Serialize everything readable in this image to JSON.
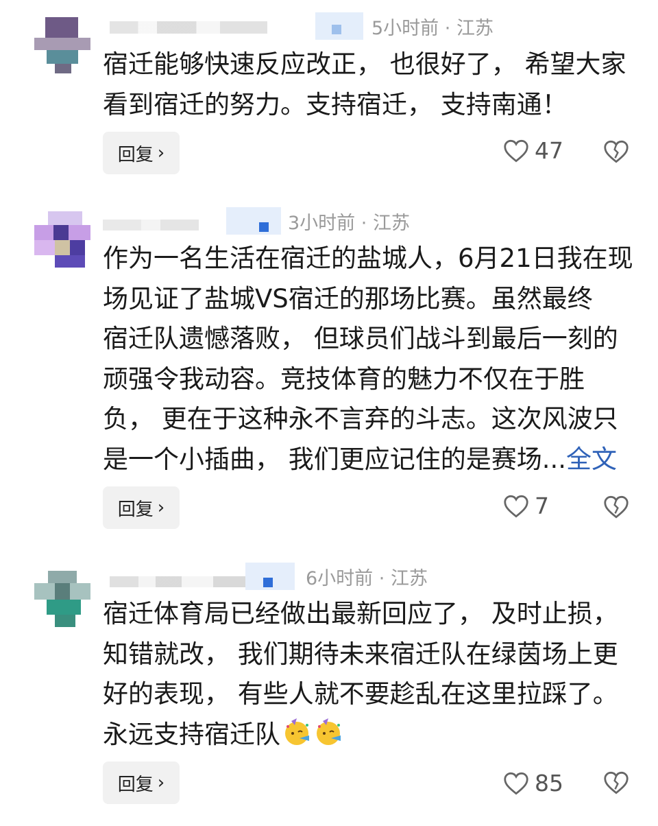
{
  "comments": [
    {
      "time": "5小时前",
      "sep": "·",
      "region": "江苏",
      "lines": [
        "宿迁能够快速反应改正， 也很好了， 希望大家",
        "看到宿迁的努力。支持宿迁， 支持南通！"
      ],
      "reply_label": "回复",
      "like_count": "47"
    },
    {
      "time": "3小时前",
      "sep": "·",
      "region": "江苏",
      "lines": [
        "作为一名生活在宿迁的盐城人，6月21日我在现",
        "场见证了盐城VS宿迁的那场比赛。虽然最终",
        "宿迁队遗憾落败， 但球员们战斗到最后一刻的",
        "顽强令我动容。竞技体育的魅力不仅在于胜",
        "负， 更在于这种永不言弃的斗志。这次风波只"
      ],
      "last_line": "是一个小插曲， 我们更应记住的是赛场...",
      "more_label": "全文",
      "reply_label": "回复",
      "like_count": "7"
    },
    {
      "time": "6小时前",
      "sep": "·",
      "region": "江苏",
      "lines": [
        "宿迁体育局已经做出最新回应了， 及时止损，",
        "知错就改， 我们期待未来宿迁队在绿茵场上更",
        "好的表现， 有些人就不要趁乱在这里拉踩了。"
      ],
      "last_line": "永远支持宿迁队",
      "emojis": [
        "party-face-emoji",
        "party-face-emoji"
      ],
      "reply_label": "回复",
      "like_count": "85"
    }
  ],
  "icons": {
    "like": "heart-outline-icon",
    "dislike": "broken-heart-icon",
    "reply_chevron": "chevron-right-icon"
  },
  "colors": {
    "link": "#2f62b8",
    "meta": "#9a9a9a",
    "reply_bg": "#f1f1f1"
  }
}
